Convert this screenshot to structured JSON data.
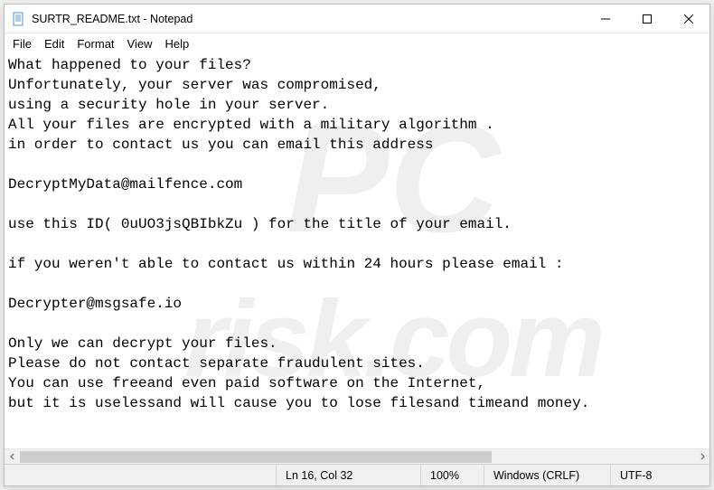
{
  "titlebar": {
    "title": "SURTR_README.txt - Notepad"
  },
  "menu": {
    "file": "File",
    "edit": "Edit",
    "format": "Format",
    "view": "View",
    "help": "Help"
  },
  "document": {
    "lines": [
      "What happened to your files?",
      "Unfortunately, your server was compromised,",
      "using a security hole in your server.",
      "All your files are encrypted with a military algorithm .",
      "in order to contact us you can email this address",
      "",
      "DecryptMyData@mailfence.com",
      "",
      "use this ID( 0uUO3jsQBIbkZu ) for the title of your email.",
      "",
      "if you weren't able to contact us within 24 hours please email :",
      "",
      "Decrypter@msgsafe.io",
      "",
      "Only we can decrypt your files.",
      "Please do not contact separate fraudulent sites.",
      "You can use freeand even paid software on the Internet,",
      "but it is uselessand will cause you to lose filesand timeand money."
    ]
  },
  "statusbar": {
    "position": "Ln 16, Col 32",
    "zoom": "100%",
    "line_ending": "Windows (CRLF)",
    "encoding": "UTF-8"
  }
}
